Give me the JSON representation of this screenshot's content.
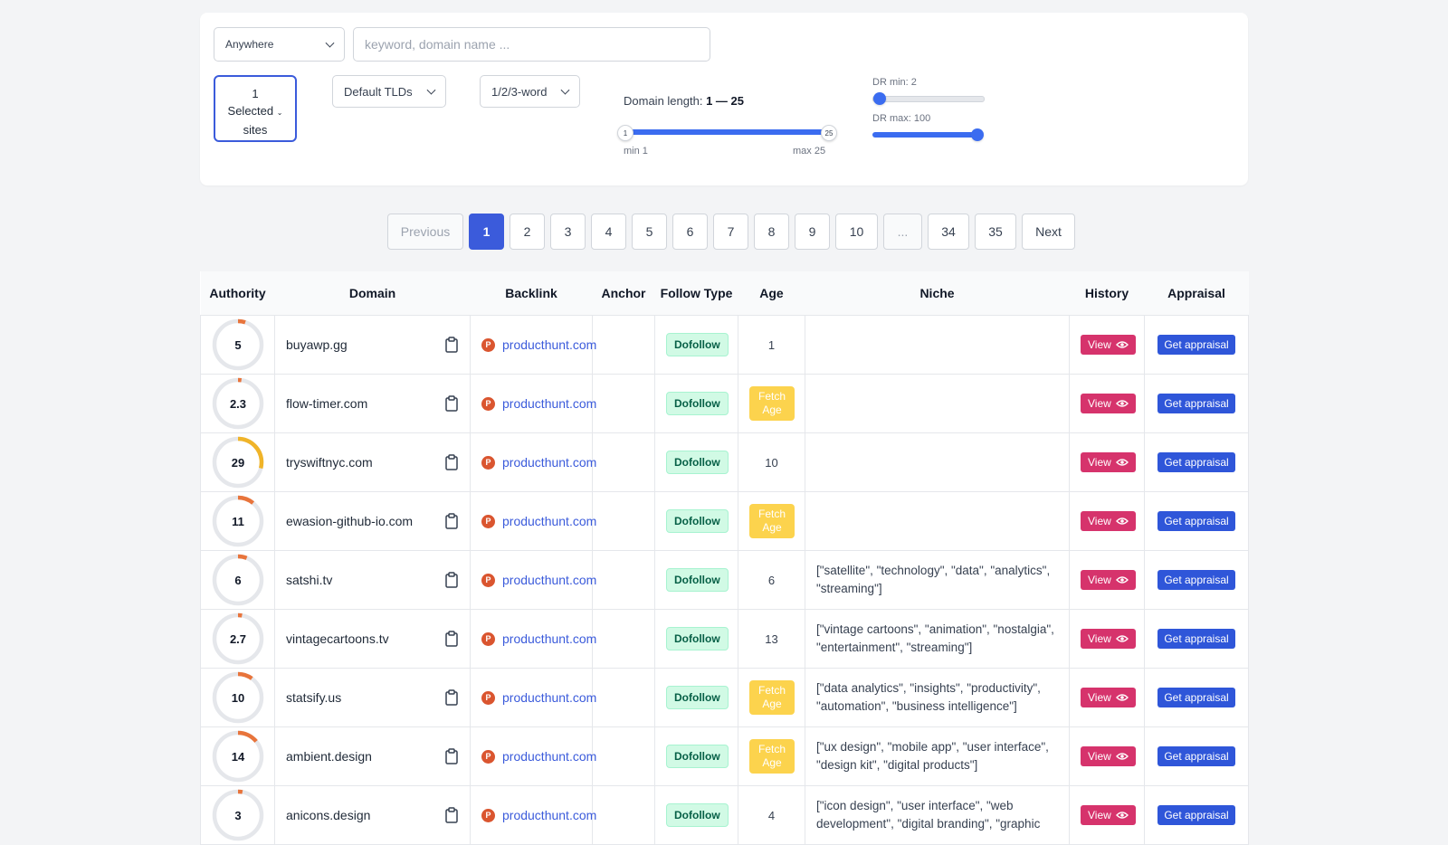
{
  "filters": {
    "location_value": "Anywhere",
    "search_placeholder": "keyword, domain name ...",
    "sites_count": "1",
    "sites_line1": "Selected",
    "sites_line2": "sites",
    "tlds_value": "Default TLDs",
    "words_value": "1/2/3-word",
    "domain_length_label": "Domain length:",
    "domain_length_range": "1 — 25",
    "length_min_knob": "1",
    "length_max_knob": "25",
    "length_min_label": "min 1",
    "length_max_label": "max 25",
    "dr_min_label": "DR min: 2",
    "dr_max_label": "DR max: 100"
  },
  "pagination": {
    "previous": "Previous",
    "pages": [
      "1",
      "2",
      "3",
      "4",
      "5",
      "6",
      "7",
      "8",
      "9",
      "10",
      "...",
      "34",
      "35"
    ],
    "active": "1",
    "next": "Next"
  },
  "table": {
    "headers": [
      "Authority",
      "Domain",
      "Backlink",
      "Anchor",
      "Follow Type",
      "Age",
      "Niche",
      "History",
      "Appraisal"
    ],
    "view_label": "View",
    "appraisal_label": "Get appraisal",
    "fetch_age_label": "Fetch Age",
    "rows": [
      {
        "authority": "5",
        "domain": "buyawp.gg",
        "backlink": "producthunt.com",
        "follow": "Dofollow",
        "age": "1",
        "niche": ""
      },
      {
        "authority": "2.3",
        "domain": "flow-timer.com",
        "backlink": "producthunt.com",
        "follow": "Dofollow",
        "age": "",
        "niche": ""
      },
      {
        "authority": "29",
        "domain": "tryswiftnyc.com",
        "backlink": "producthunt.com",
        "follow": "Dofollow",
        "age": "10",
        "niche": ""
      },
      {
        "authority": "11",
        "domain": "ewasion-github-io.com",
        "backlink": "producthunt.com",
        "follow": "Dofollow",
        "age": "",
        "niche": ""
      },
      {
        "authority": "6",
        "domain": "satshi.tv",
        "backlink": "producthunt.com",
        "follow": "Dofollow",
        "age": "6",
        "niche": "[\"satellite\", \"technology\", \"data\", \"analytics\", \"streaming\"]"
      },
      {
        "authority": "2.7",
        "domain": "vintagecartoons.tv",
        "backlink": "producthunt.com",
        "follow": "Dofollow",
        "age": "13",
        "niche": "[\"vintage cartoons\", \"animation\", \"nostalgia\", \"entertainment\", \"streaming\"]"
      },
      {
        "authority": "10",
        "domain": "statsify.us",
        "backlink": "producthunt.com",
        "follow": "Dofollow",
        "age": "",
        "niche": "[\"data analytics\", \"insights\", \"productivity\", \"automation\", \"business intelligence\"]"
      },
      {
        "authority": "14",
        "domain": "ambient.design",
        "backlink": "producthunt.com",
        "follow": "Dofollow",
        "age": "",
        "niche": "[\"ux design\", \"mobile app\", \"user interface\", \"design kit\", \"digital products\"]"
      },
      {
        "authority": "3",
        "domain": "anicons.design",
        "backlink": "producthunt.com",
        "follow": "Dofollow",
        "age": "4",
        "niche": "[\"icon design\", \"user interface\", \"web development\", \"digital branding\", \"graphic"
      }
    ]
  },
  "colors": {
    "primary": "#3b5bdb",
    "ring_low": "#e8743b",
    "ring_mid": "#f0b429",
    "view": "#d6336c",
    "fetch": "#fcd34d"
  }
}
